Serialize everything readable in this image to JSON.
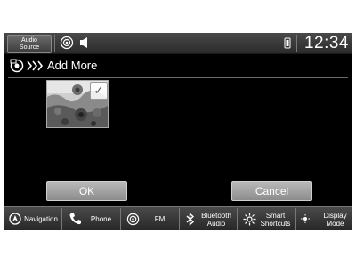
{
  "status_bar": {
    "audio_source_line1": "Audio",
    "audio_source_line2": "Source",
    "clock": "12:34"
  },
  "header": {
    "title": "Add More"
  },
  "dialog": {
    "ok_label": "OK",
    "cancel_label": "Cancel"
  },
  "bottom_bar": {
    "navigation": "Navigation",
    "phone": "Phone",
    "fm": "FM",
    "bluetooth_line1": "Bluetooth",
    "bluetooth_line2": "Audio",
    "smart_line1": "Smart",
    "smart_line2": "Shortcuts",
    "display_line1": "Display",
    "display_line2": "Mode"
  }
}
